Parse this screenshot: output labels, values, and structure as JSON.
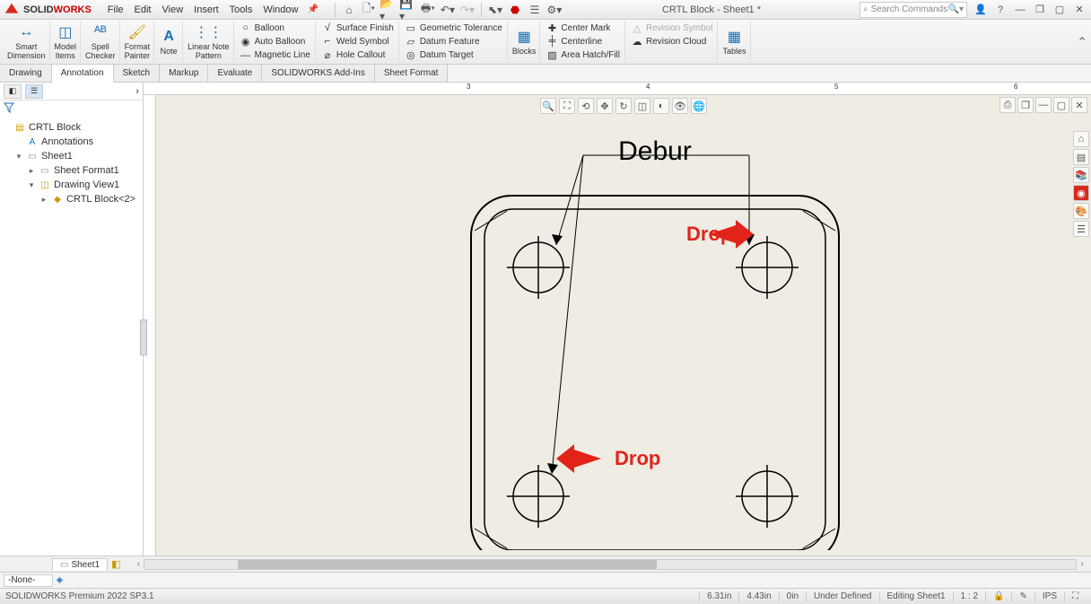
{
  "title": "CRTL Block - Sheet1 *",
  "brand": {
    "p1": "SOLID",
    "p2": "WORKS"
  },
  "menu": [
    "File",
    "Edit",
    "View",
    "Insert",
    "Tools",
    "Window"
  ],
  "search_placeholder": "Search Commands",
  "ribbon": {
    "big": [
      {
        "label": "Smart\nDimension",
        "icon": "↔"
      },
      {
        "label": "Model\nItems",
        "icon": "◫"
      },
      {
        "label": "Spell\nChecker",
        "icon": "ᴬᴮ"
      },
      {
        "label": "Format\nPainter",
        "icon": "🖌"
      },
      {
        "label": "Note",
        "icon": "A"
      },
      {
        "label": "Linear Note\nPattern",
        "icon": "⋮⋮"
      }
    ],
    "col1": [
      {
        "t": "Balloon",
        "i": "○"
      },
      {
        "t": "Auto Balloon",
        "i": "◉"
      },
      {
        "t": "Magnetic Line",
        "i": "—"
      }
    ],
    "col2": [
      {
        "t": "Surface Finish",
        "i": "√"
      },
      {
        "t": "Weld Symbol",
        "i": "⌐"
      },
      {
        "t": "Hole Callout",
        "i": "⌀"
      }
    ],
    "col3": [
      {
        "t": "Geometric Tolerance",
        "i": "▭"
      },
      {
        "t": "Datum Feature",
        "i": "▱"
      },
      {
        "t": "Datum Target",
        "i": "◎"
      }
    ],
    "blocks": {
      "label": "Blocks",
      "icon": "▦"
    },
    "col4": [
      {
        "t": "Center Mark",
        "i": "✚"
      },
      {
        "t": "Centerline",
        "i": "╪"
      },
      {
        "t": "Area Hatch/Fill",
        "i": "▨"
      }
    ],
    "col5": [
      {
        "t": "Revision Symbol",
        "i": "△",
        "dis": true
      },
      {
        "t": "Revision Cloud",
        "i": "☁"
      }
    ],
    "tables": {
      "label": "Tables",
      "icon": "▦"
    }
  },
  "tabs": [
    "Drawing",
    "Annotation",
    "Sketch",
    "Markup",
    "Evaluate",
    "SOLIDWORKS Add-Ins",
    "Sheet Format"
  ],
  "active_tab": 1,
  "tree": {
    "root": "CRTL Block",
    "anno": "Annotations",
    "sheet": "Sheet1",
    "sf": "Sheet Format1",
    "dv": "Drawing View1",
    "part": "CRTL Block<2>"
  },
  "drawing": {
    "note": "Debur",
    "drop1": "Drop",
    "drop2": "Drop"
  },
  "sheet_tab": "Sheet1",
  "layer": "-None-",
  "status": {
    "product": "SOLIDWORKS Premium 2022 SP3.1",
    "x": "6.31in",
    "y": "4.43in",
    "z": "0in",
    "def": "Under Defined",
    "editing": "Editing Sheet1",
    "scale": "1 : 2",
    "units": "IPS"
  },
  "ruler_marks": [
    "3",
    "4",
    "5",
    "6"
  ]
}
